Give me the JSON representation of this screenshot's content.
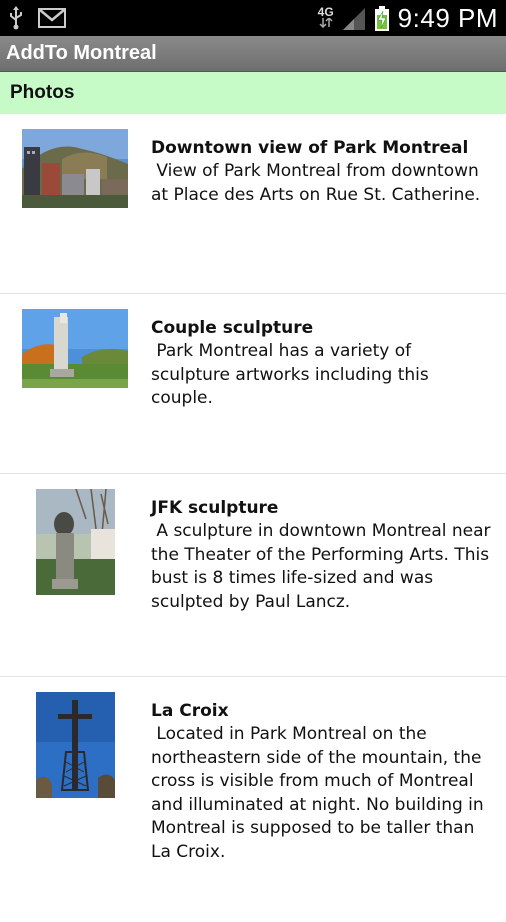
{
  "status_bar": {
    "network": "4G",
    "time": "9:49 PM"
  },
  "app": {
    "title": "AddTo Montreal"
  },
  "section": {
    "title": "Photos"
  },
  "items": [
    {
      "title": "Downtown view of Park Montreal",
      "description": " View of Park Montreal from downtown at Place des Arts on Rue St. Catherine."
    },
    {
      "title": "Couple sculpture",
      "description": " Park Montreal has a variety of sculpture artworks including this couple."
    },
    {
      "title": "JFK sculpture",
      "description": " A sculpture in downtown Montreal near the Theater of the Performing Arts. This bust is 8 times life-sized and was sculpted by Paul Lancz."
    },
    {
      "title": "La Croix",
      "description": " Located in Park Montreal on the northeastern side of the mountain, the cross is visible from much of Montreal and illuminated at night. No building in Montreal is supposed to be taller than La Croix."
    }
  ]
}
